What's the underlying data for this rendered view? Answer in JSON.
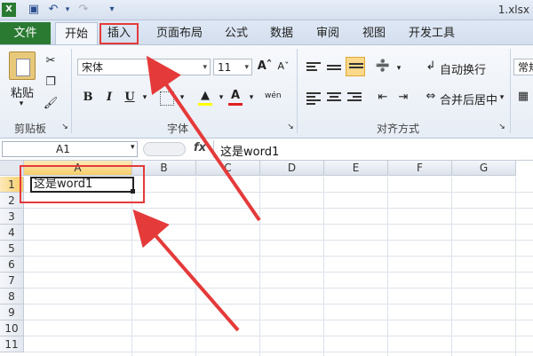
{
  "window": {
    "filename": "1.xlsx"
  },
  "tabs": [
    {
      "label": "文件"
    },
    {
      "label": "开始"
    },
    {
      "label": "插入"
    },
    {
      "label": "页面布局"
    },
    {
      "label": "公式"
    },
    {
      "label": "数据"
    },
    {
      "label": "审阅"
    },
    {
      "label": "视图"
    },
    {
      "label": "开发工具"
    }
  ],
  "ribbon": {
    "clipboard": {
      "paste_label": "粘贴",
      "group_label": "剪贴板"
    },
    "font": {
      "name": "宋体",
      "size": "11",
      "bold": "B",
      "italic": "I",
      "underline": "U",
      "wen": "wén",
      "group_label": "字体"
    },
    "alignment": {
      "wrap_label": "自动换行",
      "merge_label": "合并后居中",
      "group_label": "对齐方式"
    },
    "number": {
      "format": "常规"
    }
  },
  "formula_bar": {
    "name_box": "A1",
    "fx": "fx",
    "content": "这是word1"
  },
  "grid": {
    "columns": [
      "A",
      "B",
      "C",
      "D",
      "E",
      "F",
      "G"
    ],
    "rows": [
      "1",
      "2",
      "3",
      "4",
      "5",
      "6",
      "7",
      "8",
      "9",
      "10",
      "11"
    ],
    "a1_value": "这是word1"
  },
  "colors": {
    "file_tab": "#2a7a32",
    "annotation": "#e53a3a"
  }
}
